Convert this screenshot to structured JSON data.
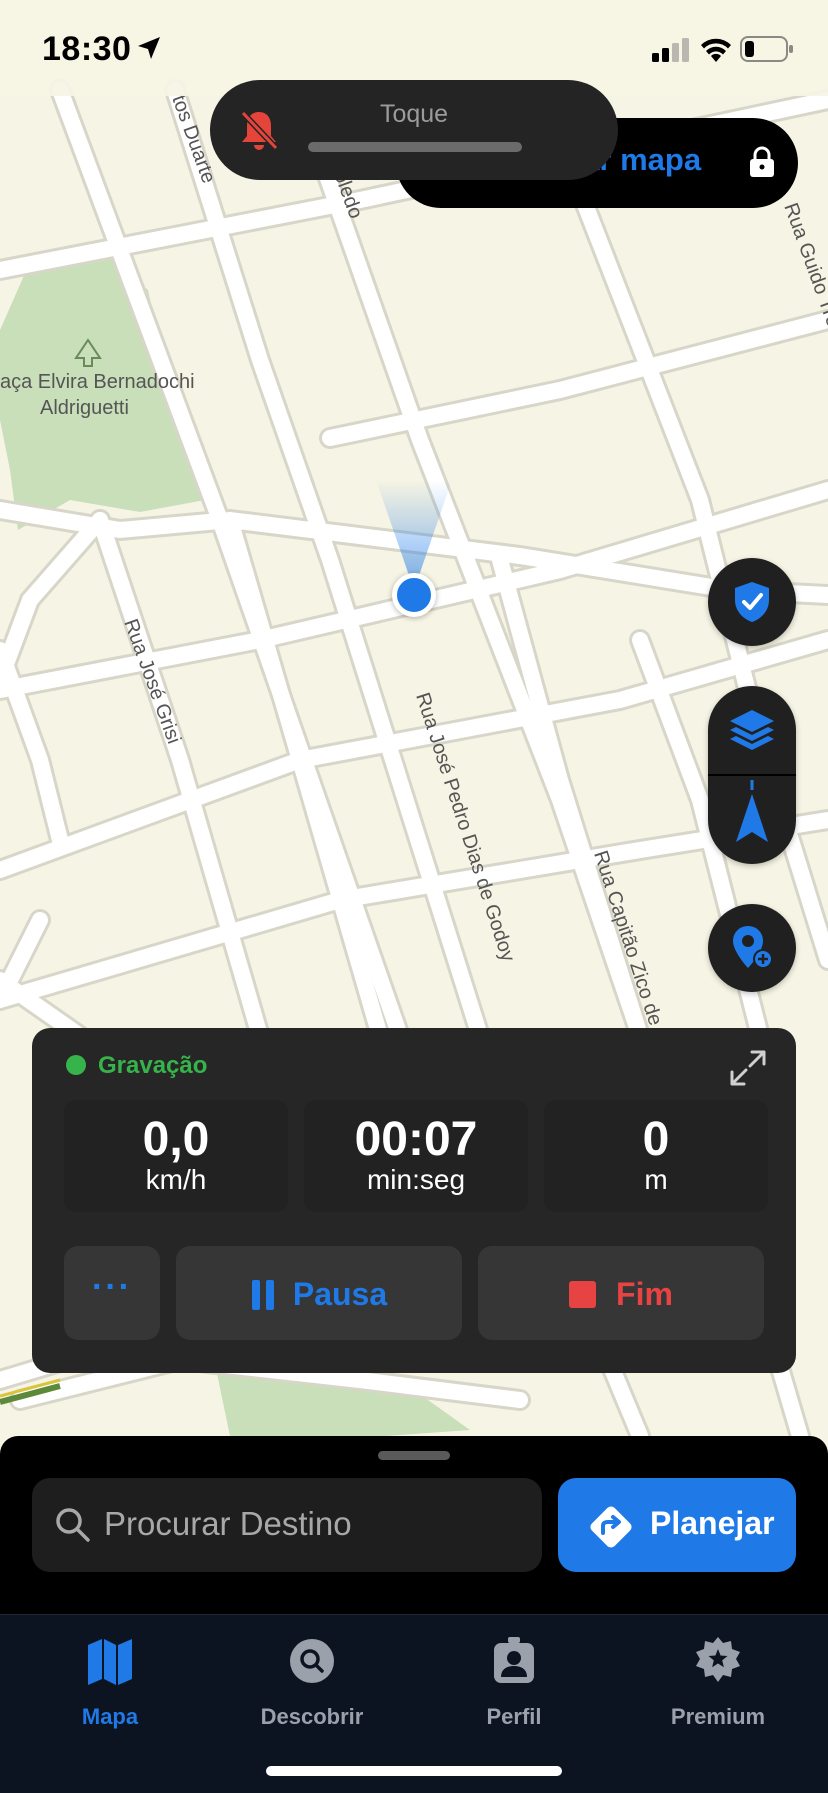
{
  "status_bar": {
    "time": "18:30",
    "location_icon": "location-arrow-icon",
    "signal_icon": "cellular-signal-icon",
    "wifi_icon": "wifi-icon",
    "battery_icon": "battery-low-icon"
  },
  "notification": {
    "label": "Toque",
    "icon": "bell-muted-icon",
    "icon_color": "#e5443a"
  },
  "map_lock": {
    "label": "egar mapa",
    "icon": "lock-icon"
  },
  "map": {
    "labels": {
      "park": "aça Elvira Bernadochi",
      "park_line2": "Aldriguetti",
      "duarte": "tos Duarte",
      "toledo": "oledo",
      "guido": "Rua Guido Trevise",
      "grisi": "Rua José Grisi",
      "godoy": "Rua José Pedro Dias de Godoy",
      "zico": "Rua Capitão Zico de"
    },
    "colors": {
      "background": "#f6f4e4",
      "road": "#ffffff",
      "road_edge": "#d8d6c8",
      "park": "#c8dfba"
    }
  },
  "map_controls": {
    "shield": "shield-check-icon",
    "layers": "layers-icon",
    "north": "north-arrow-icon",
    "add_poi": "add-place-icon"
  },
  "recording": {
    "status": "Gravação",
    "status_color": "#36b34a",
    "expand_icon": "expand-icon",
    "stats": [
      {
        "value": "0,0",
        "unit": "km/h"
      },
      {
        "value": "00:07",
        "unit": "min:seg"
      },
      {
        "value": "0",
        "unit": "m"
      }
    ],
    "more_label": "···",
    "pause_label": "Pausa",
    "stop_label": "Fim",
    "pause_color": "#1f7ae8",
    "stop_color": "#e84343"
  },
  "search": {
    "placeholder": "Procurar Destino",
    "plan_label": "Planejar",
    "accent": "#1f7ae8"
  },
  "tabs": [
    {
      "label": "Mapa",
      "icon": "map-icon",
      "active": true
    },
    {
      "label": "Descobrir",
      "icon": "discover-icon",
      "active": false
    },
    {
      "label": "Perfil",
      "icon": "profile-icon",
      "active": false
    },
    {
      "label": "Premium",
      "icon": "premium-badge-icon",
      "active": false
    }
  ]
}
